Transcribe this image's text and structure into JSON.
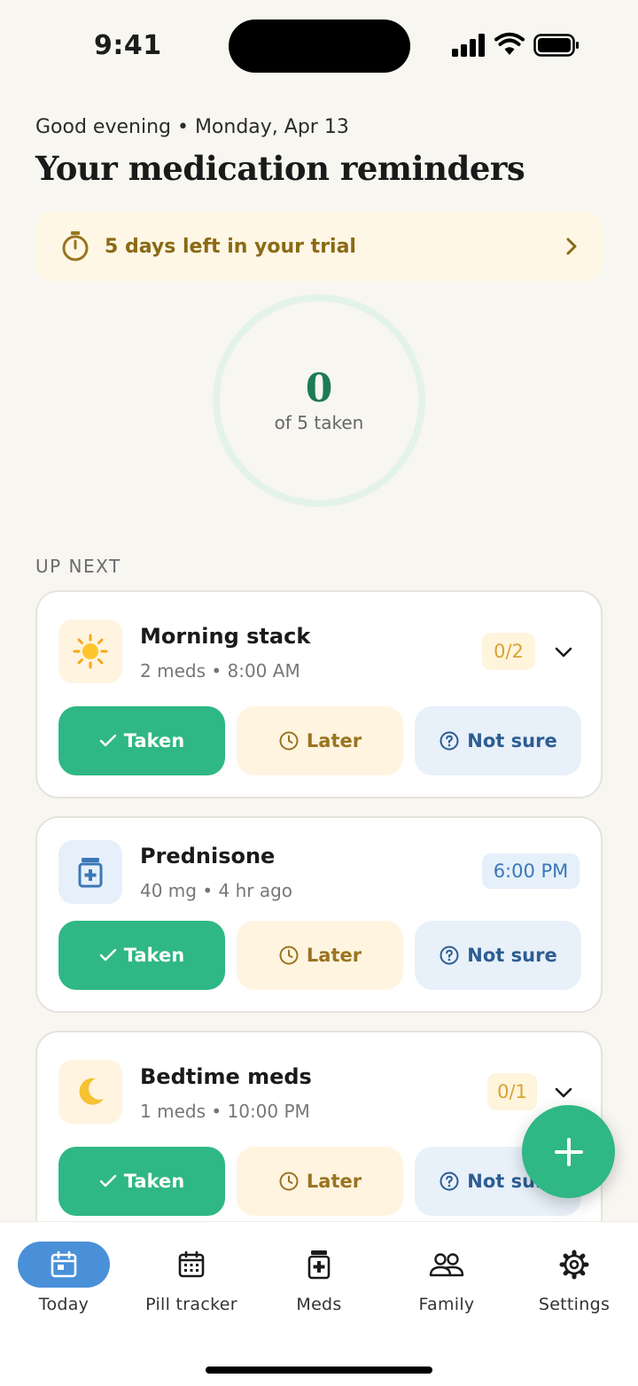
{
  "status": {
    "time": "9:41"
  },
  "header": {
    "greeting": "Good evening • Monday, Apr 13",
    "title": "Your medication reminders"
  },
  "trial": {
    "text": "5 days left in your trial",
    "icon": "stopwatch-icon"
  },
  "progress": {
    "count": "0",
    "label": "of 5 taken",
    "taken": 0,
    "total": 5
  },
  "section_label": "UP NEXT",
  "cards": [
    {
      "title": "Morning stack",
      "subtitle": "2 meds • 8:00 AM",
      "badge": "0/2",
      "icon": "sun-icon",
      "actions": {
        "taken": "Taken",
        "later": "Later",
        "unsure": "Not sure"
      }
    },
    {
      "title": "Prednisone",
      "subtitle": "40 mg • 4 hr ago",
      "badge": "6:00 PM",
      "icon": "pill-bottle-icon",
      "actions": {
        "taken": "Taken",
        "later": "Later",
        "unsure": "Not sure"
      }
    },
    {
      "title": "Bedtime meds",
      "subtitle": "1 meds • 10:00 PM",
      "badge": "0/1",
      "icon": "moon-icon",
      "actions": {
        "taken": "Taken",
        "later": "Later",
        "unsure": "Not sure"
      }
    }
  ],
  "tabs": [
    {
      "label": "Today",
      "icon": "calendar-icon",
      "active": true
    },
    {
      "label": "Pill tracker",
      "icon": "calendar-grid-icon",
      "active": false
    },
    {
      "label": "Meds",
      "icon": "pill-bottle-icon",
      "active": false
    },
    {
      "label": "Family",
      "icon": "people-icon",
      "active": false
    },
    {
      "label": "Settings",
      "icon": "gear-icon",
      "active": false
    }
  ],
  "colors": {
    "accent": "#2fb785",
    "active_tab": "#4a90d9",
    "background": "#f8f6f1"
  }
}
